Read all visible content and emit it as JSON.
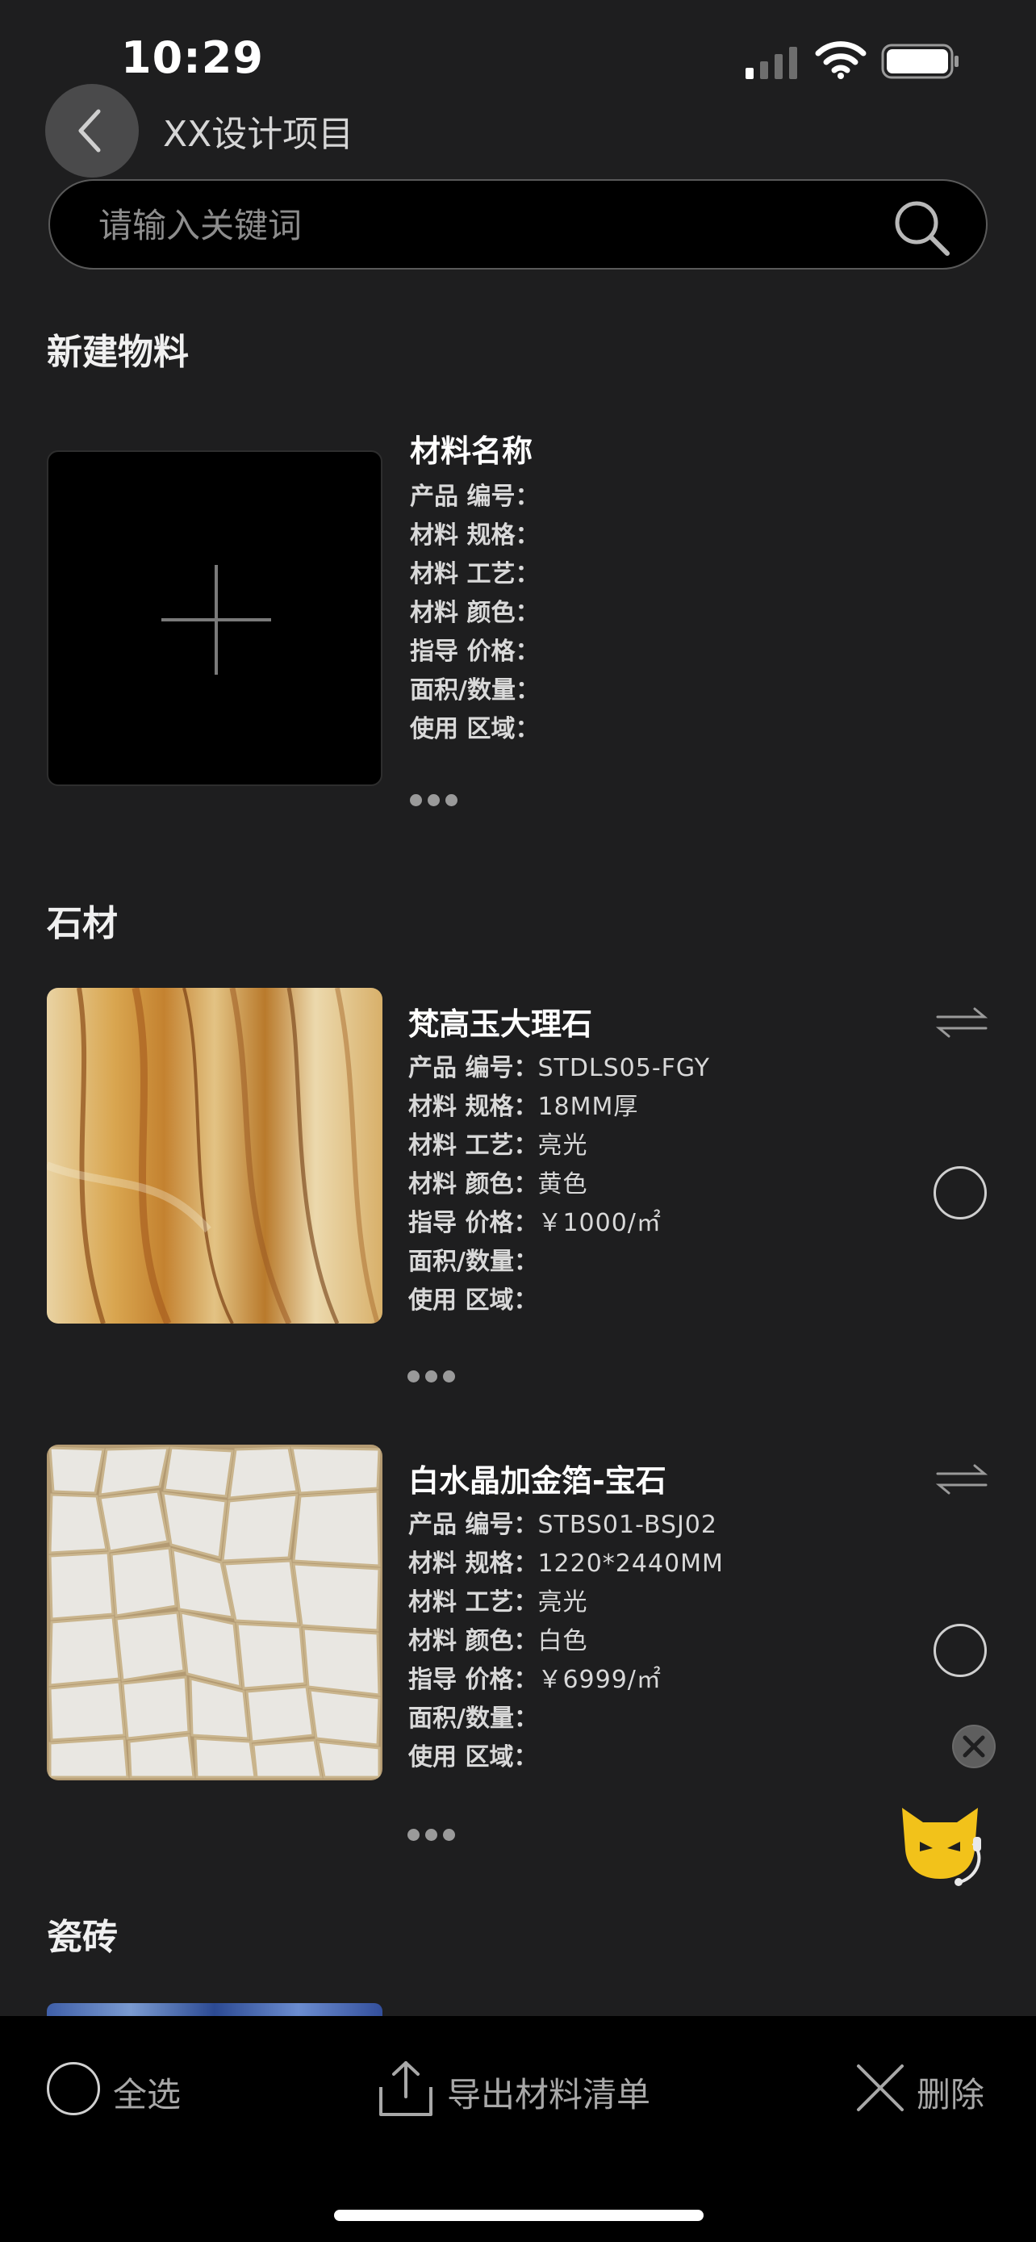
{
  "status": {
    "time": "10:29"
  },
  "nav": {
    "title": "XX设计项目"
  },
  "search": {
    "placeholder": "请输入关键词"
  },
  "new_material": {
    "section_title": "新建物料",
    "name_label": "材料名称",
    "fields": [
      {
        "label": "产品 编号：",
        "value": ""
      },
      {
        "label": "材料 规格：",
        "value": ""
      },
      {
        "label": "材料 工艺：",
        "value": ""
      },
      {
        "label": "材料 颜色：",
        "value": ""
      },
      {
        "label": "指导 价格：",
        "value": ""
      },
      {
        "label": "面积/数量：",
        "value": ""
      },
      {
        "label": "使用 区域：",
        "value": ""
      }
    ]
  },
  "stone_section": {
    "title": "石材"
  },
  "items": [
    {
      "name": "梵高玉大理石",
      "image": "yellow-marble-texture",
      "fields": [
        {
          "label": "产品 编号：",
          "value": "STDLS05-FGY"
        },
        {
          "label": "材料 规格：",
          "value": "18MM厚"
        },
        {
          "label": "材料 工艺：",
          "value": "亮光"
        },
        {
          "label": "材料 颜色：",
          "value": "黄色"
        },
        {
          "label": "指导 价格：",
          "value": "￥1000/㎡"
        },
        {
          "label": "面积/数量：",
          "value": ""
        },
        {
          "label": "使用 区域：",
          "value": ""
        }
      ]
    },
    {
      "name": "白水晶加金箔-宝石",
      "image": "white-crystal-gold-leaf-texture",
      "fields": [
        {
          "label": "产品 编号：",
          "value": "STBS01-BSJ02"
        },
        {
          "label": "材料 规格：",
          "value": "1220*2440MM"
        },
        {
          "label": "材料 工艺：",
          "value": "亮光"
        },
        {
          "label": "材料 颜色：",
          "value": "白色"
        },
        {
          "label": "指导 价格：",
          "value": "￥6999/㎡"
        },
        {
          "label": "面积/数量：",
          "value": ""
        },
        {
          "label": "使用 区域：",
          "value": ""
        }
      ]
    }
  ],
  "tile_section": {
    "title": "瓷砖"
  },
  "bottom_bar": {
    "select_all": "全选",
    "export": "导出材料清单",
    "delete": "删除"
  },
  "icons": {
    "back": "chevron-left-icon",
    "search": "search-icon",
    "swap": "swap-arrows-icon",
    "export": "upload-icon",
    "delete": "x-icon",
    "mascot": "cat-assistant-icon"
  },
  "colors": {
    "background": "#1e1e1f",
    "bottom_bar": "#000000",
    "mascot": "#f2c21a"
  }
}
